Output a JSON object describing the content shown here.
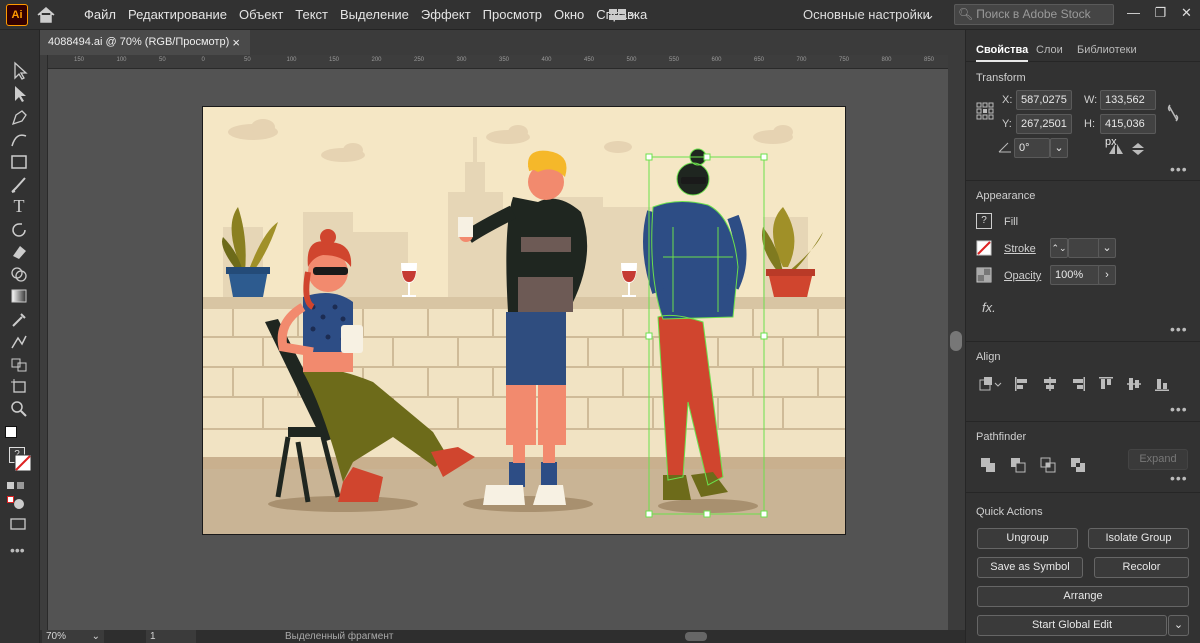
{
  "app": {
    "logo": "Ai"
  },
  "menu": [
    "Файл",
    "Редактирование",
    "Объект",
    "Текст",
    "Выделение",
    "Эффект",
    "Просмотр",
    "Окно",
    "Справка"
  ],
  "workspace": "Основные настройки",
  "stock_placeholder": "Поиск в Adobe Stock",
  "document": {
    "tab_title": "4088494.ai @ 70% (RGB/Просмотр)",
    "close": "×"
  },
  "ruler_ticks": [
    "150",
    "100",
    "50",
    "0",
    "50",
    "100",
    "150",
    "200",
    "250",
    "300",
    "350",
    "400",
    "450",
    "500",
    "550",
    "600",
    "650",
    "700",
    "750",
    "800",
    "850"
  ],
  "status": {
    "zoom": "70%",
    "artboard": "1",
    "info": "Выделенный фрагмент"
  },
  "panel": {
    "tabs": [
      "Свойства",
      "Слои",
      "Библиотеки"
    ],
    "transform": {
      "title": "Transform",
      "x_label": "X:",
      "x": "587,0275 p",
      "y_label": "Y:",
      "y": "267,2501 p",
      "w_label": "W:",
      "w": "133,562 px",
      "h_label": "H:",
      "h": "415,036 px",
      "angle": "0°"
    },
    "appearance": {
      "title": "Appearance",
      "fill": "Fill",
      "stroke": "Stroke",
      "opacity": "Opacity",
      "opacity_value": "100%"
    },
    "align": {
      "title": "Align"
    },
    "pathfinder": {
      "title": "Pathfinder",
      "expand": "Expand"
    },
    "quick_actions": {
      "title": "Quick Actions",
      "ungroup": "Ungroup",
      "isolate": "Isolate Group",
      "save_symbol": "Save as Symbol",
      "recolor": "Recolor",
      "arrange": "Arrange",
      "global_edit": "Start Global Edit"
    }
  }
}
